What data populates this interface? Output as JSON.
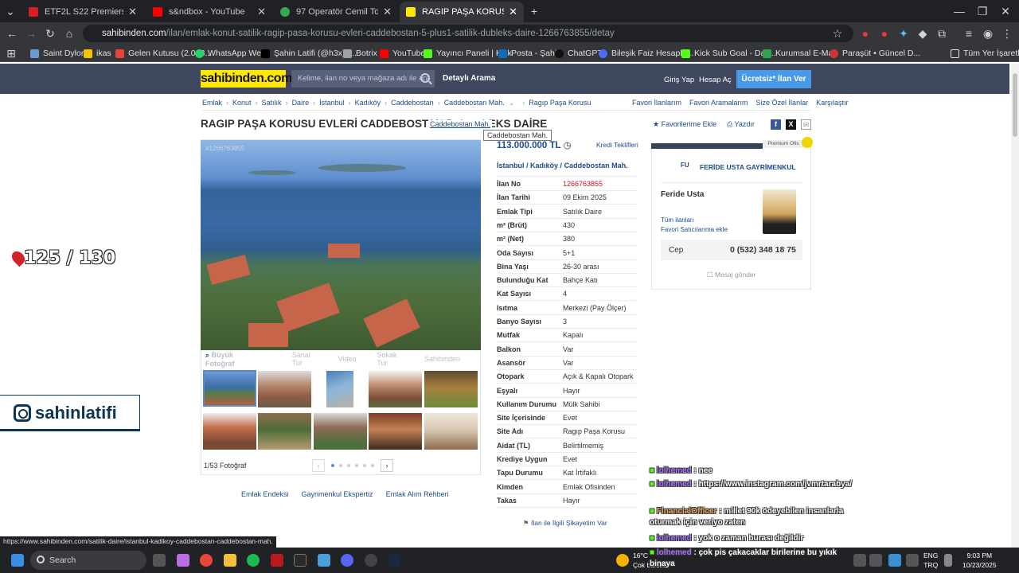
{
  "browser": {
    "tabs": [
      {
        "label": "ETF2L S22 Premiership Playoffs",
        "color": "#d71e28"
      },
      {
        "label": "s&ndbox - YouTube",
        "color": "#ff0000"
      },
      {
        "label": "97 Operatör Cemil Topuzlu Cd.",
        "color": "#34a853"
      },
      {
        "label": "RAGIP PAŞA KORUSU EVLERİ C",
        "color": "#ffe800"
      }
    ],
    "url_host": "sahibinden.com",
    "url_path": "/ilan/emlak-konut-satilik-ragip-pasa-korusu-evleri-caddebostan-5-plus1-satilik-dubleks-daire-1266763855/detay",
    "bookmarks": [
      {
        "label": "Saint Dylon",
        "color": "#6c9bd2"
      },
      {
        "label": "ikas",
        "color": "#f5c400"
      },
      {
        "label": "Gelen Kutusu (2.008...",
        "color": "#ea4335"
      },
      {
        "label": "WhatsApp Web",
        "color": "#25d366"
      },
      {
        "label": "Şahin Latifi (@h3x) /...",
        "color": "#000000"
      },
      {
        "label": "Botrix",
        "color": "#9aa0a6"
      },
      {
        "label": "YouTube",
        "color": "#ff0000"
      },
      {
        "label": "Yayıncı Paneli | Kick",
        "color": "#53fc18"
      },
      {
        "label": "Posta - Şahin",
        "color": "#0f6cbd"
      },
      {
        "label": "ChatGPT",
        "color": "#111111"
      },
      {
        "label": "Bileşik Faiz Hesapla...",
        "color": "#4a6cf7"
      },
      {
        "label": "Kick Sub Goal - Dail...",
        "color": "#53fc18"
      },
      {
        "label": "Kurumsal E-Mail",
        "color": "#2da44e"
      },
      {
        "label": "Paraşüt • Güncel D...",
        "color": "#d13438"
      }
    ],
    "all_bookmarks": "Tüm Yer İşaretleri",
    "status_url": "https://www.sahibinden.com/satilik-daire/istanbul-kadikoy-caddebostan-caddebostan-mah."
  },
  "header": {
    "logo": "sahibinden.com",
    "search_placeholder": "Kelime, ilan no veya mağaza adı ile ara",
    "advanced_search": "Detaylı Arama",
    "login": "Giriş Yap",
    "register": "Hesap Aç",
    "post_ad": "Ücretsiz* İlan Ver"
  },
  "breadcrumb": [
    "Emlak",
    "Konut",
    "Satılık",
    "Daire",
    "İstanbul",
    "Kadıköy",
    "Caddebostan",
    "Caddebostan Mah.",
    "Ragıp Paşa Korusu"
  ],
  "quick_links": [
    "Favori İlanlarım",
    "Favori Aramalarım",
    "Size Özel İlanlar",
    "Karşılaştır"
  ],
  "listing": {
    "title": "RAGIP PAŞA KORUSU EVLERİ CADDEBOSTAN 5+1 SATILIK DUBLEKS DAİRE",
    "title_visible": "RAGIP PAŞA KORUSU EVLERİ CADDEBOSTAN 5+1",
    "title_tail": "LEKS DAİRE",
    "hover_link": "Caddebostan Mah.",
    "tooltip": "Caddebostan Mah.",
    "favorite": "Favorilerime Ekle",
    "print": "Yazdır",
    "price": "113.000.000 TL",
    "credit_offers": "Kredi Teklifleri",
    "location": [
      "İstanbul",
      "Kadıköy",
      "Caddebostan Mah."
    ],
    "photo_id": "#1266763855",
    "photo_tabs": [
      "Büyük Fotoğraf",
      "Sanal Tur",
      "Video",
      "Sokak Tur",
      "Sahibinden"
    ],
    "photo_count": "1/53 Fotoğraf",
    "complaint": "İlan ile İlgili Şikayetim Var",
    "details": [
      {
        "k": "İlan No",
        "v": "1266763855",
        "red": true
      },
      {
        "k": "İlan Tarihi",
        "v": "09 Ekim 2025"
      },
      {
        "k": "Emlak Tipi",
        "v": "Satılık Daire"
      },
      {
        "k": "m² (Brüt)",
        "v": "430"
      },
      {
        "k": "m² (Net)",
        "v": "380"
      },
      {
        "k": "Oda Sayısı",
        "v": "5+1"
      },
      {
        "k": "Bina Yaşı",
        "v": "26-30 arası"
      },
      {
        "k": "Bulunduğu Kat",
        "v": "Bahçe Katı"
      },
      {
        "k": "Kat Sayısı",
        "v": "4"
      },
      {
        "k": "Isıtma",
        "v": "Merkezi (Pay Ölçer)"
      },
      {
        "k": "Banyo Sayısı",
        "v": "3"
      },
      {
        "k": "Mutfak",
        "v": "Kapalı"
      },
      {
        "k": "Balkon",
        "v": "Var"
      },
      {
        "k": "Asansör",
        "v": "Var"
      },
      {
        "k": "Otopark",
        "v": "Açık & Kapalı Otopark"
      },
      {
        "k": "Eşyalı",
        "v": "Hayır"
      },
      {
        "k": "Kullanım Durumu",
        "v": "Mülk Sahibi"
      },
      {
        "k": "Site İçerisinde",
        "v": "Evet"
      },
      {
        "k": "Site Adı",
        "v": "Ragıp Paşa Korusu"
      },
      {
        "k": "Aidat (TL)",
        "v": "Belirtilmemiş"
      },
      {
        "k": "Krediye Uygun",
        "v": "Evet"
      },
      {
        "k": "Tapu Durumu",
        "v": "Kat İrtifaklı"
      },
      {
        "k": "Kimden",
        "v": "Emlak Ofisinden"
      },
      {
        "k": "Takas",
        "v": "Hayır"
      }
    ]
  },
  "seller": {
    "premium": "Premium Ofis",
    "agency": "FERİDE USTA GAYRİMENKUL",
    "name": "Feride Usta",
    "all_ads": "Tüm ilanları",
    "fav_sellers": "Favori Satıcılarıma ekle",
    "phone_label": "Cep",
    "phone": "0 (532) 348 18 75",
    "message": "Mesaj gönder"
  },
  "footer_links": [
    "Emlak Endeksi",
    "Gayrimenkul Ekspertiz",
    "Emlak Alım Rehberi"
  ],
  "overlay": {
    "counter": "125 / 130",
    "instagram": "sahinlatifi",
    "chat": [
      {
        "user": "lolhemed",
        "msg": ": nee",
        "cls": "u"
      },
      {
        "user": "lolhemed",
        "msg": ": https://www.instagram.com/jvmrtarabya/",
        "cls": "u"
      },
      {
        "user": "FinancialOfficer",
        "msg": ": millet 90k ödeyebilen insanlarla oturmak için veriyo zaten",
        "cls": "u2"
      },
      {
        "user": "lolhemed",
        "msg": ": yok o zaman burası değildir",
        "cls": "u"
      },
      {
        "user": "lolhemed",
        "msg": ": çok pis çakacaklar birilerine bu yıkık binaya",
        "cls": "u"
      }
    ]
  },
  "taskbar": {
    "search": "Search",
    "weather_temp": "16°C",
    "weather_text": "Çok bulutlu",
    "lang1": "ENG",
    "lang2": "TRQ",
    "time": "9:03 PM",
    "date": "10/23/2025"
  }
}
